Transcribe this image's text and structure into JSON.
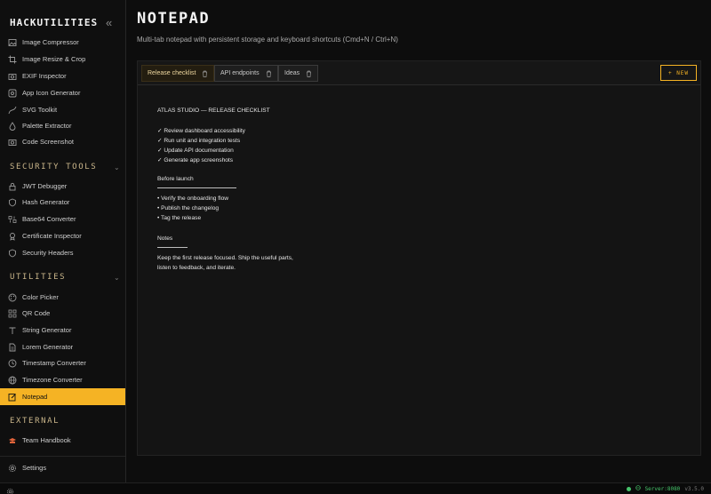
{
  "sidebar": {
    "brand": "HACKUTILITIES",
    "collapse_glyph": "«",
    "items_top": [
      {
        "label": "Image Compressor",
        "icon": "image-icon"
      },
      {
        "label": "Image Resize & Crop",
        "icon": "crop-icon"
      },
      {
        "label": "EXIF Inspector",
        "icon": "camera-icon"
      },
      {
        "label": "App Icon Generator",
        "icon": "app-icon"
      },
      {
        "label": "SVG Toolkit",
        "icon": "pen-curve-icon"
      },
      {
        "label": "Palette Extractor",
        "icon": "droplet-icon"
      },
      {
        "label": "Code Screenshot",
        "icon": "camera-icon"
      }
    ],
    "security": {
      "title": "SECURITY TOOLS",
      "items": [
        {
          "label": "JWT Debugger",
          "icon": "lock-icon"
        },
        {
          "label": "Hash Generator",
          "icon": "shield-icon"
        },
        {
          "label": "Base64 Converter",
          "icon": "binary-icon"
        },
        {
          "label": "Certificate Inspector",
          "icon": "certificate-icon"
        },
        {
          "label": "Security Headers",
          "icon": "shield-icon"
        }
      ]
    },
    "utilities": {
      "title": "UTILITIES",
      "items": [
        {
          "label": "Color Picker",
          "icon": "palette-icon"
        },
        {
          "label": "QR Code",
          "icon": "qr-icon"
        },
        {
          "label": "String Generator",
          "icon": "type-icon"
        },
        {
          "label": "Lorem Generator",
          "icon": "file-text-icon"
        },
        {
          "label": "Timestamp Converter",
          "icon": "clock-icon"
        },
        {
          "label": "Timezone Converter",
          "icon": "globe-icon"
        },
        {
          "label": "Notepad",
          "icon": "notepad-icon",
          "active": true
        }
      ]
    },
    "external": {
      "title": "EXTERNAL",
      "items": [
        {
          "label": "Team Handbook",
          "icon": "handbook-icon"
        }
      ]
    },
    "settings_label": "Settings"
  },
  "page": {
    "title": "NOTEPAD",
    "subtitle": "Multi-tab notepad with persistent storage and keyboard shortcuts (Cmd+N / Ctrl+N)"
  },
  "tabs": [
    {
      "label": "Release checklist",
      "active": true
    },
    {
      "label": "API endpoints",
      "active": false
    },
    {
      "label": "Ideas",
      "active": false
    }
  ],
  "new_button_label": "+ NEW",
  "note": {
    "heading": "ATLAS STUDIO — RELEASE CHECKLIST",
    "checklist": [
      "✓ Review dashboard accessibility",
      "✓ Run unit and integration tests",
      "✓ Update API documentation",
      "✓ Generate app screenshots"
    ],
    "before_launch_title": "Before launch",
    "before_launch": [
      "• Verify the onboarding flow",
      "• Publish the changelog",
      "• Tag the release"
    ],
    "notes_title": "Notes",
    "notes_lines": [
      "Keep the first release focused. Ship the useful parts,",
      "listen to feedback, and iterate."
    ]
  },
  "status": {
    "server": "Server:8080",
    "version": "v3.5.0"
  },
  "colors": {
    "accent": "#f5b324",
    "background": "#0d0d0d",
    "server_ok": "#46c46b"
  }
}
